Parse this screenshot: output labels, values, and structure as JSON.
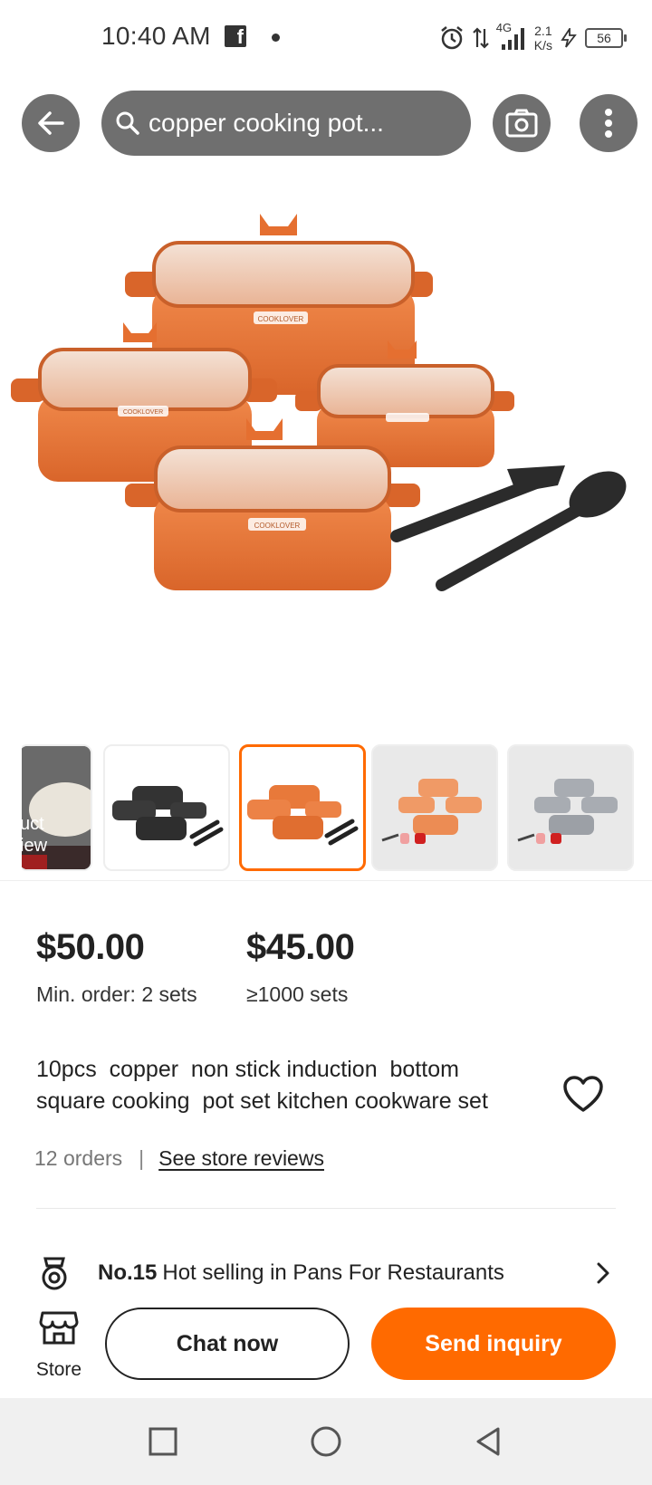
{
  "status_bar": {
    "time": "10:40 AM",
    "network_type": "4G",
    "net_speed_value": "2.1",
    "net_speed_unit": "K/s",
    "battery": "56"
  },
  "header": {
    "search_query": "copper cooking pot..."
  },
  "gallery": {
    "partial_thumb_label_line1": "uct",
    "partial_thumb_label_line2": "iew",
    "selected_index": 2
  },
  "pricing": {
    "tier1_price": "$50.00",
    "tier1_quantity": "Min. order: 2 sets",
    "tier2_price": "$45.00",
    "tier2_quantity": "≥1000 sets"
  },
  "product": {
    "title": "10pcs  copper  non stick induction  bottom\nsquare cooking  pot set kitchen cookware set",
    "orders": "12 orders",
    "reviews_link": "See store reviews",
    "brand_label": "COOKLOVER"
  },
  "ranking": {
    "rank": "No.15",
    "text": "Hot selling in Pans For Restaurants"
  },
  "actions": {
    "store_label": "Store",
    "chat_label": "Chat now",
    "inquiry_label": "Send inquiry"
  },
  "colors": {
    "accent": "#ff6a00",
    "pot_copper": "#e8793a",
    "header_gray": "#6f6f6f"
  }
}
